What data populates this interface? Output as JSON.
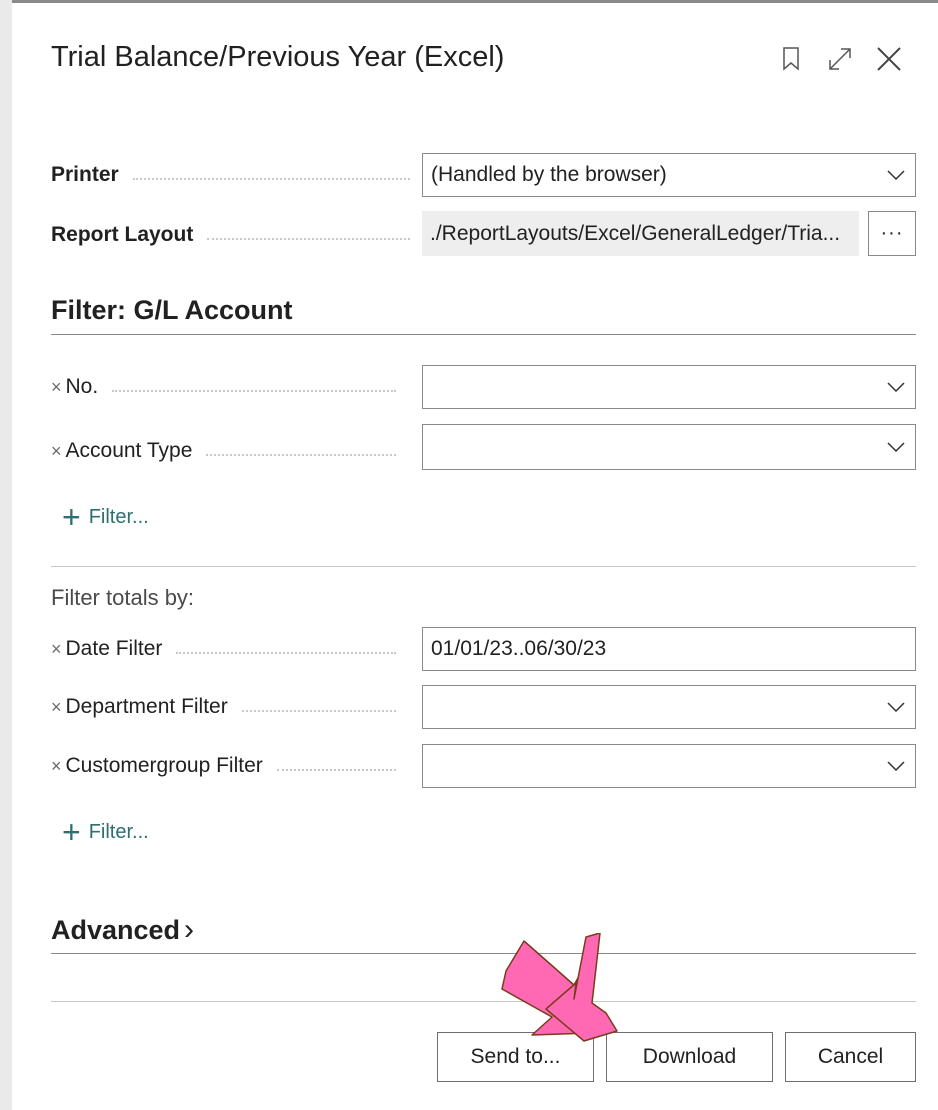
{
  "dialog": {
    "title": "Trial Balance/Previous Year (Excel)",
    "icons": [
      "bookmark-icon",
      "expand-icon",
      "close-icon"
    ]
  },
  "options": {
    "printer_label": "Printer",
    "printer_value": "(Handled by the browser)",
    "layout_label": "Report Layout",
    "layout_value": "./ReportLayouts/Excel/GeneralLedger/Tria...",
    "layout_button": "···"
  },
  "filter_account": {
    "heading": "Filter: G/L Account",
    "rows": [
      {
        "label": "No.",
        "value": ""
      },
      {
        "label": "Account Type",
        "value": ""
      }
    ],
    "add_filter": "Filter..."
  },
  "filter_totals": {
    "heading": "Filter totals by:",
    "rows": [
      {
        "label": "Date Filter",
        "value": "01/01/23..06/30/23"
      },
      {
        "label": "Department Filter",
        "value": ""
      },
      {
        "label": "Customergroup Filter",
        "value": ""
      }
    ],
    "add_filter": "Filter..."
  },
  "advanced": {
    "label": "Advanced",
    "chevron": "›"
  },
  "remove_glyph": "×",
  "footer": {
    "send_to": "Send to...",
    "download": "Download",
    "cancel": "Cancel"
  },
  "colors": {
    "accent": "#2e6f6f",
    "arrow_fill": "#ff69b4",
    "arrow_stroke": "#7a3b1a"
  }
}
